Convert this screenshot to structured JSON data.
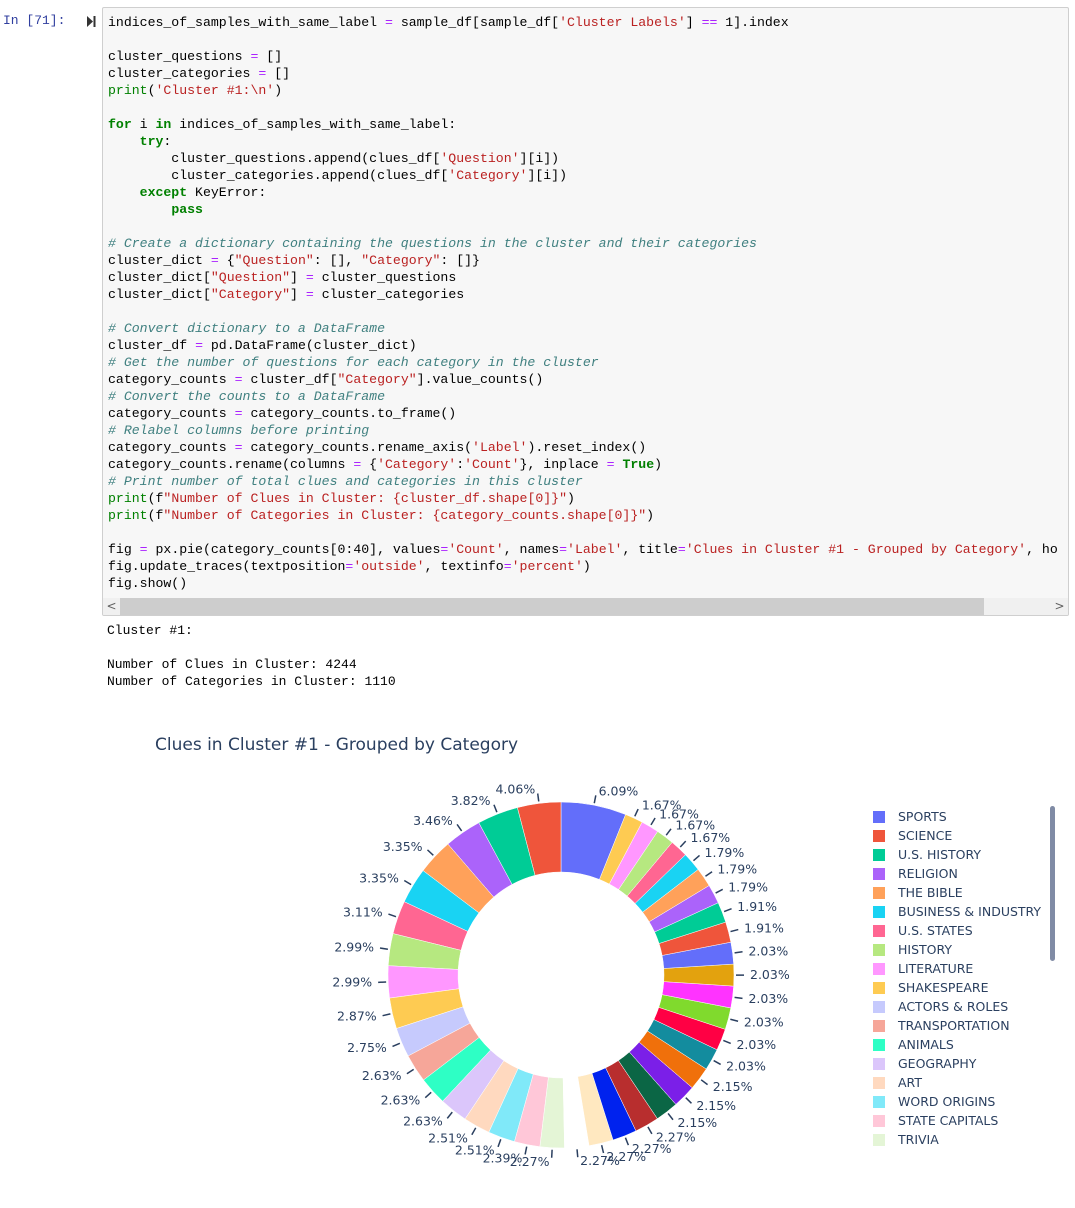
{
  "cell": {
    "prompt": "In [71]:",
    "run_icon": "run-cell-icon",
    "code": {
      "lines": [
        "indices_of_samples_with_same_label = sample_df[sample_df['Cluster Labels'] == 1].index",
        "",
        "cluster_questions = []",
        "cluster_categories = []",
        "print('Cluster #1:\\n')",
        "",
        "for i in indices_of_samples_with_same_label:",
        "    try:",
        "        cluster_questions.append(clues_df['Question'][i])",
        "        cluster_categories.append(clues_df['Category'][i])",
        "    except KeyError:",
        "        pass",
        "",
        "# Create a dictionary containing the questions in the cluster and their categories",
        "cluster_dict = {\"Question\": [], \"Category\": []}",
        "cluster_dict[\"Question\"] = cluster_questions",
        "cluster_dict[\"Category\"] = cluster_categories",
        "",
        "# Convert dictionary to a DataFrame",
        "cluster_df = pd.DataFrame(cluster_dict)",
        "# Get the number of questions for each category in the cluster",
        "category_counts = cluster_df[\"Category\"].value_counts()",
        "# Convert the counts to a DataFrame",
        "category_counts = category_counts.to_frame()",
        "# Relabel columns before printing",
        "category_counts = category_counts.rename_axis('Label').reset_index()",
        "category_counts.rename(columns = {'Category':'Count'}, inplace = True)",
        "# Print number of total clues and categories in this cluster",
        "print(f\"Number of Clues in Cluster: {cluster_df.shape[0]}\")",
        "print(f\"Number of Categories in Cluster: {category_counts.shape[0]}\")",
        "",
        "fig = px.pie(category_counts[0:40], values='Count', names='Label', title='Clues in Cluster #1 - Grouped by Category', ho",
        "fig.update_traces(textposition='outside', textinfo='percent')",
        "fig.show()"
      ]
    },
    "scroll_left": "<",
    "scroll_right": ">"
  },
  "output": {
    "line1": "Cluster #1:",
    "line2": "Number of Clues in Cluster: 4244",
    "line3": "Number of Categories in Cluster: 1110"
  },
  "chart_data": {
    "type": "pie",
    "hole": true,
    "title": "Clues in Cluster #1 - Grouped by Category",
    "textinfo": "percent",
    "legend_position": "right",
    "legend_scrollable": true,
    "legend_labels": [
      "SPORTS",
      "SCIENCE",
      "U.S. HISTORY",
      "RELIGION",
      "THE BIBLE",
      "BUSINESS & INDUSTRY",
      "U.S. STATES",
      "HISTORY",
      "LITERATURE",
      "SHAKESPEARE",
      "ACTORS & ROLES",
      "TRANSPORTATION",
      "ANIMALS",
      "GEOGRAPHY",
      "ART",
      "WORD ORIGINS",
      "STATE CAPITALS",
      "TRIVIA"
    ],
    "percents": [
      6.09,
      4.06,
      3.82,
      3.46,
      3.35,
      3.35,
      3.11,
      2.99,
      2.99,
      2.87,
      2.75,
      2.63,
      2.63,
      2.63,
      2.51,
      2.51,
      2.39,
      2.27,
      2.27,
      2.27,
      2.27,
      2.27,
      2.15,
      2.15,
      2.15,
      2.03,
      2.03,
      2.03,
      2.03,
      2.03,
      2.03,
      1.91,
      1.91,
      1.79,
      1.79,
      1.79,
      1.67,
      1.67,
      1.67,
      1.67
    ],
    "colors": [
      "#636EFA",
      "#EF553B",
      "#00CC96",
      "#AB63FA",
      "#FFA15A",
      "#19D3F3",
      "#FF6692",
      "#B6E880",
      "#FF97FF",
      "#FECB52",
      "#C6CAFD",
      "#F6A699",
      "#2EFFC5",
      "#DBC6FB",
      "#FFD9BF",
      "#80E9F9",
      "#FFC7D8",
      "#E4F5D6",
      "#FFFFFF",
      "#FFE8C0",
      "#0022EE",
      "#B82E2E",
      "#0B6645",
      "#7B1FE8",
      "#F0700B",
      "#138C9E",
      "#FF0044",
      "#80DA2D",
      "#FF33FF",
      "#E3A20E",
      "#636EFA",
      "#EF553B",
      "#00CC96",
      "#AB63FA",
      "#FFA15A",
      "#19D3F3",
      "#FF6692",
      "#B6E880",
      "#FF97FF",
      "#FECB52"
    ]
  }
}
